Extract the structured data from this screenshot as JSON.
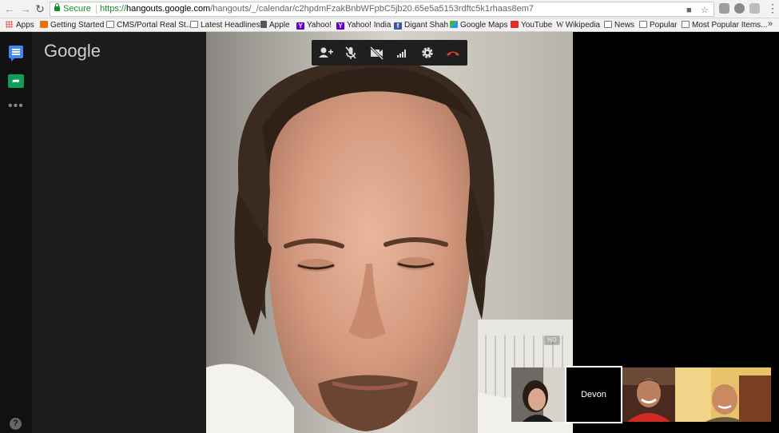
{
  "browser": {
    "secure_label": "Secure",
    "url_protocol": "https://",
    "url_host": "hangouts.google.com",
    "url_path": "/hangouts/_/calendar/c2hpdmFzakBnbWFpbC5jb20.65e5a5153rdftc5k1rhaas8em7",
    "bookmarks": [
      {
        "label": "Apps",
        "icon": "apps-grid-icon"
      },
      {
        "label": "Getting Started",
        "icon": "firefox-icon"
      },
      {
        "label": "CMS/Portal Real St...",
        "icon": "folder-icon"
      },
      {
        "label": "Latest Headlines",
        "icon": "folder-icon"
      },
      {
        "label": "Apple",
        "icon": "apple-icon"
      },
      {
        "label": "Yahoo!",
        "icon": "yahoo-icon"
      },
      {
        "label": "Yahoo! India",
        "icon": "yahoo-icon"
      },
      {
        "label": "Digant Shah",
        "icon": "facebook-icon"
      },
      {
        "label": "Google Maps",
        "icon": "maps-icon"
      },
      {
        "label": "YouTube",
        "icon": "youtube-icon"
      },
      {
        "label": "Wikipedia",
        "icon": "wikipedia-icon"
      },
      {
        "label": "News",
        "icon": "folder-icon"
      },
      {
        "label": "Popular",
        "icon": "folder-icon"
      },
      {
        "label": "Most Popular Items...",
        "icon": "folder-icon"
      }
    ],
    "overflow_label": "»"
  },
  "hangouts": {
    "logo": "Google",
    "help_label": "?",
    "more_label": "•••",
    "toolbar": [
      "add-person-icon",
      "mute-mic-icon",
      "video-off-icon",
      "signal-icon",
      "settings-icon",
      "hang-up-icon"
    ],
    "hd_label": "HD",
    "participants": [
      {
        "name": "",
        "kind": "video"
      },
      {
        "name": "Devon",
        "kind": "avatar"
      },
      {
        "name": "",
        "kind": "video"
      },
      {
        "name": "",
        "kind": "video"
      }
    ]
  },
  "colors": {
    "secure_green": "#1a8a2a",
    "hangouts_blue": "#4285f4",
    "hangouts_green": "#0f9d58",
    "hangup_red": "#e53935",
    "toolbar_bg": "#1f1f1f"
  }
}
